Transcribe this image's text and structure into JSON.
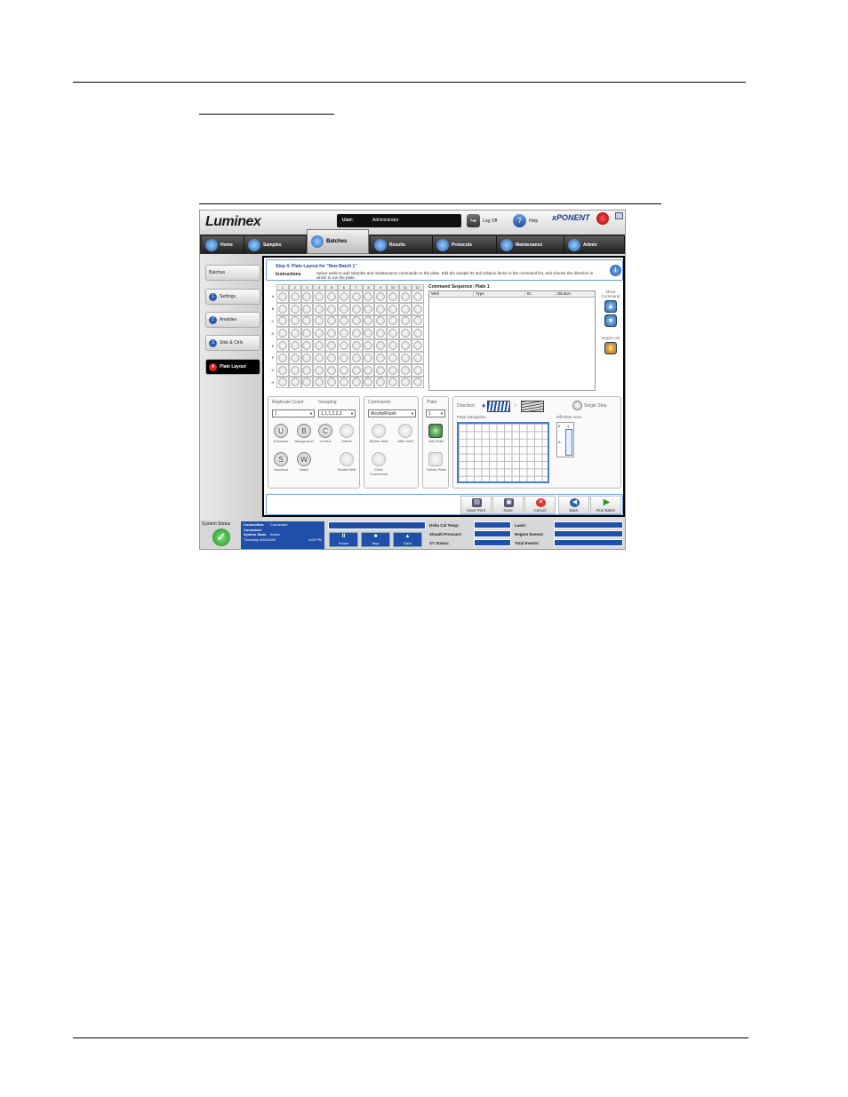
{
  "window": {
    "logo": "Luminex",
    "user_label": "User:",
    "user_value": "Administrator",
    "logoff_label": "Log Off",
    "help_label": "Help",
    "product": "xPONENT"
  },
  "tabs": [
    {
      "label": "Home"
    },
    {
      "label": "Samples"
    },
    {
      "label": "Batches"
    },
    {
      "label": "Results"
    },
    {
      "label": "Protocols"
    },
    {
      "label": "Maintenance"
    },
    {
      "label": "Admin"
    }
  ],
  "sidebar": {
    "items": [
      {
        "label": "Batches",
        "num": ""
      },
      {
        "label": "Settings",
        "num": "1"
      },
      {
        "label": "Analytes",
        "num": "2"
      },
      {
        "label": "Stds & Ctrls",
        "num": "3"
      },
      {
        "label": "Plate Layout",
        "num": "4"
      }
    ]
  },
  "step": {
    "title": "Step 4: Plate Layout for \"New Batch 1\"",
    "instructions_label": "Instructions",
    "instructions_text": "Select wells to add samples and maintenance commands to the plate. Edit the sample ID and Dilution factor in the command list, and choose the direction in which to run the plate."
  },
  "plate": {
    "columns": [
      "1",
      "2",
      "3",
      "4",
      "5",
      "6",
      "7",
      "8",
      "9",
      "10",
      "11",
      "12"
    ],
    "rows": [
      "A",
      "B",
      "C",
      "D",
      "E",
      "F",
      "G",
      "H"
    ]
  },
  "command_sequence": {
    "title": "Command Sequence: Plate 1",
    "headers": [
      "Well",
      "Type",
      "ID",
      "Dilution"
    ]
  },
  "side_tools": {
    "move_command": "Move Command",
    "import_list": "Import List"
  },
  "replicate": {
    "title": "Replicate Count",
    "value": "1",
    "grouping_title": "Grouping",
    "grouping_value": "1,1,1,2,2,2",
    "buttons": [
      {
        "glyph": "U",
        "label": "Unknown"
      },
      {
        "glyph": "B",
        "label": "Background"
      },
      {
        "glyph": "C",
        "label": "Control"
      },
      {
        "glyph": "",
        "label": "Delete"
      },
      {
        "glyph": "S",
        "label": "Standard"
      },
      {
        "glyph": "W",
        "label": "Wash"
      },
      {
        "glyph": "",
        "label": "Startat Well"
      }
    ]
  },
  "commands": {
    "title": "Commands",
    "value": "AlcoholFlush",
    "before_well": "Before Well",
    "after_well": "After Well",
    "clear_commands": "Clear Commands"
  },
  "plate_panel": {
    "title": "Plate",
    "value": "1",
    "add_plate": "Add Plate",
    "delete_plate": "Delete Plate"
  },
  "direction": {
    "label": "Direction:",
    "single_step": "Single Step",
    "plate_navigation": "Plate Navigation",
    "off_plate_area": "Off Plate Area",
    "off_plate_cols": [
      "0",
      "1"
    ],
    "off_plate_row": "A"
  },
  "actions": {
    "save_print": "Save Print",
    "save": "Save",
    "cancel": "Cancel",
    "back": "Back",
    "run_batch": "Run Batch"
  },
  "status": {
    "title": "System Status",
    "connection_label": "Connection:",
    "connection_value": "Connected",
    "command_label": "Command:",
    "command_value": "",
    "system_state_label": "System State:",
    "system_state_value": "Active",
    "date": "Thursday 6/26/2008",
    "time": "4:00 PM",
    "pause": "Pause",
    "stop": "Stop",
    "eject": "Eject",
    "delta_cal_temp": "Delta Cal Temp:",
    "sheath_pressure": "Sheath Pressure:",
    "xy_status": "XY Status:",
    "laser": "Laser:",
    "region_events": "Region Events:",
    "total_events": "Total Events:"
  },
  "colors": {
    "accent": "#1f4fa8",
    "frame": "#6a9be0"
  }
}
